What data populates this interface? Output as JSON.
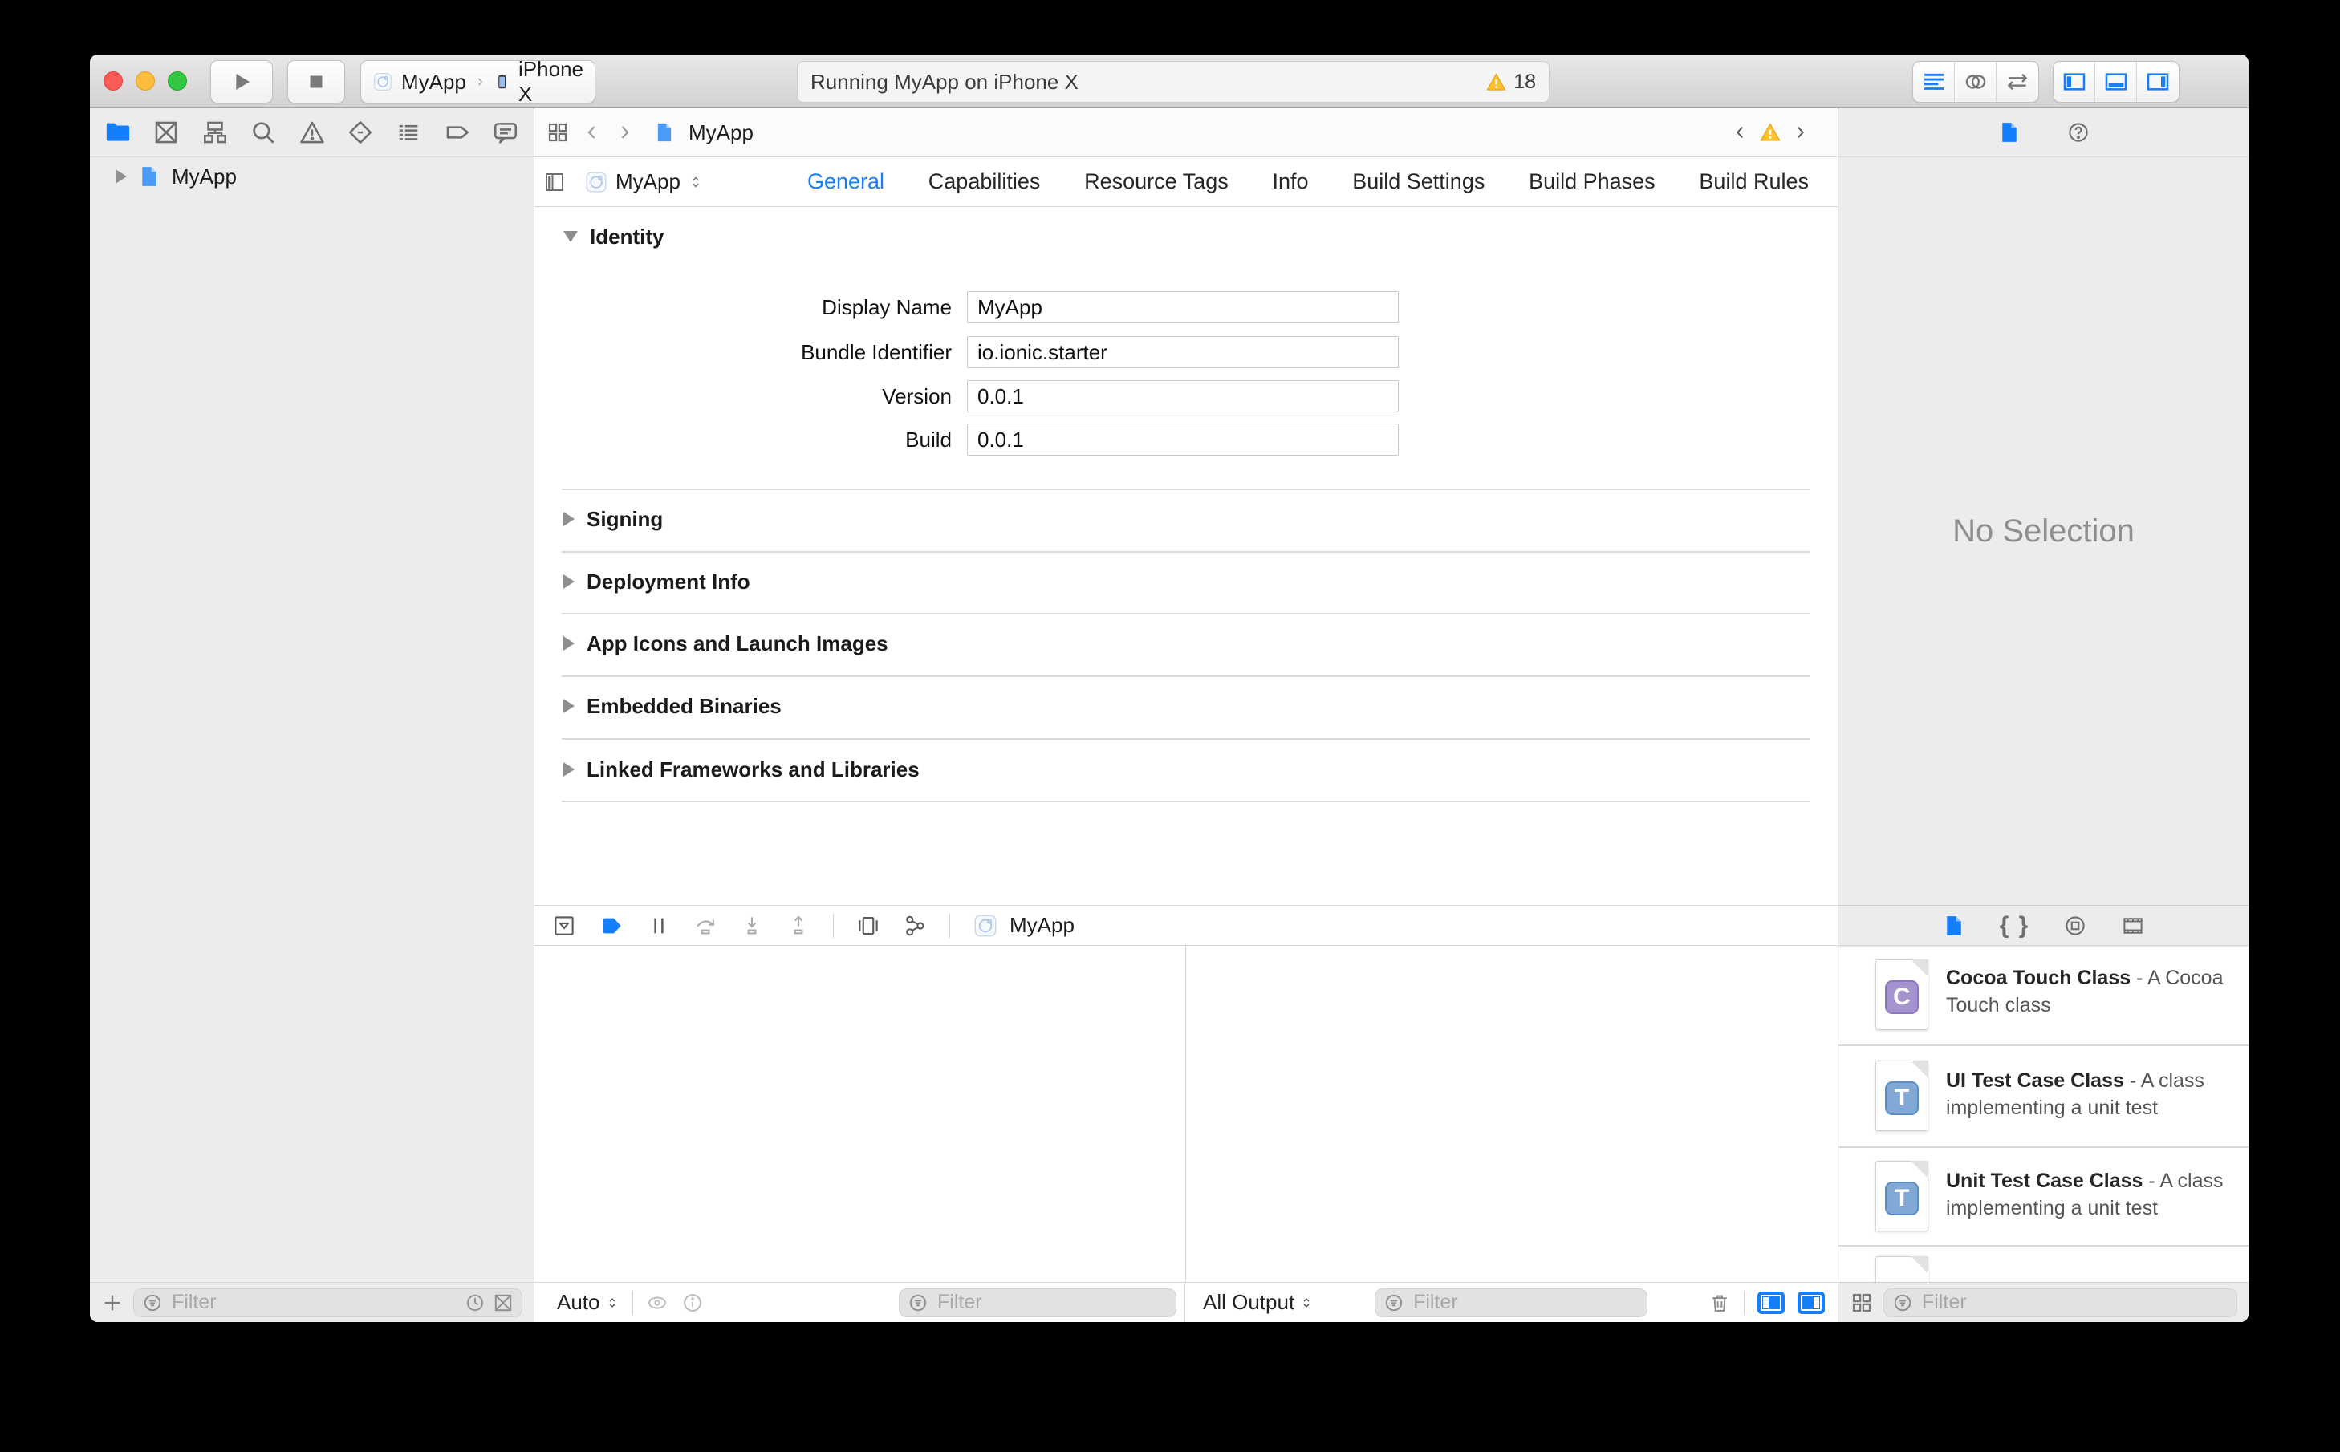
{
  "colors": {
    "accent_blue": "#157EFB",
    "warning_yellow": "#FDBF2D",
    "panel_gray": "#ECECEC",
    "no_selection_gray": "#8E8E93"
  },
  "toolbar": {
    "scheme": {
      "target": "MyApp",
      "device": "iPhone X"
    },
    "status": {
      "message": "Running MyApp on iPhone X",
      "warning_count": "18"
    }
  },
  "navigator": {
    "project": "MyApp",
    "filter_placeholder": "Filter"
  },
  "editor": {
    "jumpbar": {
      "item": "MyApp"
    },
    "header": {
      "target": "MyApp"
    },
    "tabs": [
      {
        "label": "General"
      },
      {
        "label": "Capabilities"
      },
      {
        "label": "Resource Tags"
      },
      {
        "label": "Info"
      },
      {
        "label": "Build Settings"
      },
      {
        "label": "Build Phases"
      },
      {
        "label": "Build Rules"
      }
    ],
    "identity": {
      "title": "Identity",
      "fields": [
        {
          "label": "Display Name",
          "value": "MyApp"
        },
        {
          "label": "Bundle Identifier",
          "value": "io.ionic.starter"
        },
        {
          "label": "Version",
          "value": "0.0.1"
        },
        {
          "label": "Build",
          "value": "0.0.1"
        }
      ]
    },
    "collapsed_sections": [
      "Signing",
      "Deployment Info",
      "App Icons and Launch Images",
      "Embedded Binaries",
      "Linked Frameworks and Libraries"
    ],
    "debug": {
      "target": "MyApp",
      "variables_scope": "Auto",
      "console_scope": "All Output",
      "variables_filter_placeholder": "Filter",
      "console_filter_placeholder": "Filter"
    }
  },
  "utilities": {
    "no_selection": "No Selection",
    "library": {
      "items": [
        {
          "title": "Cocoa Touch Class",
          "desc": "- A Cocoa Touch class",
          "badge": "C"
        },
        {
          "title": "UI Test Case Class",
          "desc": "- A class implementing a unit test",
          "badge": "T"
        },
        {
          "title": "Unit Test Case Class",
          "desc": "- A class implementing a unit test",
          "badge": "T"
        }
      ],
      "filter_placeholder": "Filter"
    }
  }
}
